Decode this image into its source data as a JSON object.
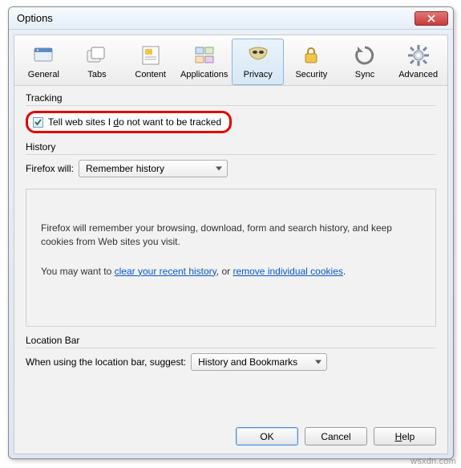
{
  "window": {
    "title": "Options"
  },
  "toolbar": {
    "tabs": [
      {
        "label": "General"
      },
      {
        "label": "Tabs"
      },
      {
        "label": "Content"
      },
      {
        "label": "Applications"
      },
      {
        "label": "Privacy"
      },
      {
        "label": "Security"
      },
      {
        "label": "Sync"
      },
      {
        "label": "Advanced"
      }
    ],
    "active_index": 4
  },
  "tracking": {
    "legend": "Tracking",
    "dnt_checked": true,
    "dnt_prefix": "Tell web sites I ",
    "dnt_accel": "d",
    "dnt_suffix": "o not want to be tracked"
  },
  "history": {
    "legend": "History",
    "label": "Firefox will:",
    "select_value": "Remember history",
    "desc_line": "Firefox will remember your browsing, download, form and search history, and keep cookies from Web sites you visit.",
    "hint_prefix": "You may want to ",
    "hint_link1": "clear your recent history",
    "hint_mid": ", or ",
    "hint_link2": "remove individual cookies",
    "hint_suffix": "."
  },
  "location_bar": {
    "legend": "Location Bar",
    "label": "When using the location bar, suggest:",
    "select_value": "History and Bookmarks"
  },
  "buttons": {
    "ok": "OK",
    "cancel": "Cancel",
    "help_accel": "H",
    "help_rest": "elp"
  },
  "watermark": "wsxdn.com"
}
